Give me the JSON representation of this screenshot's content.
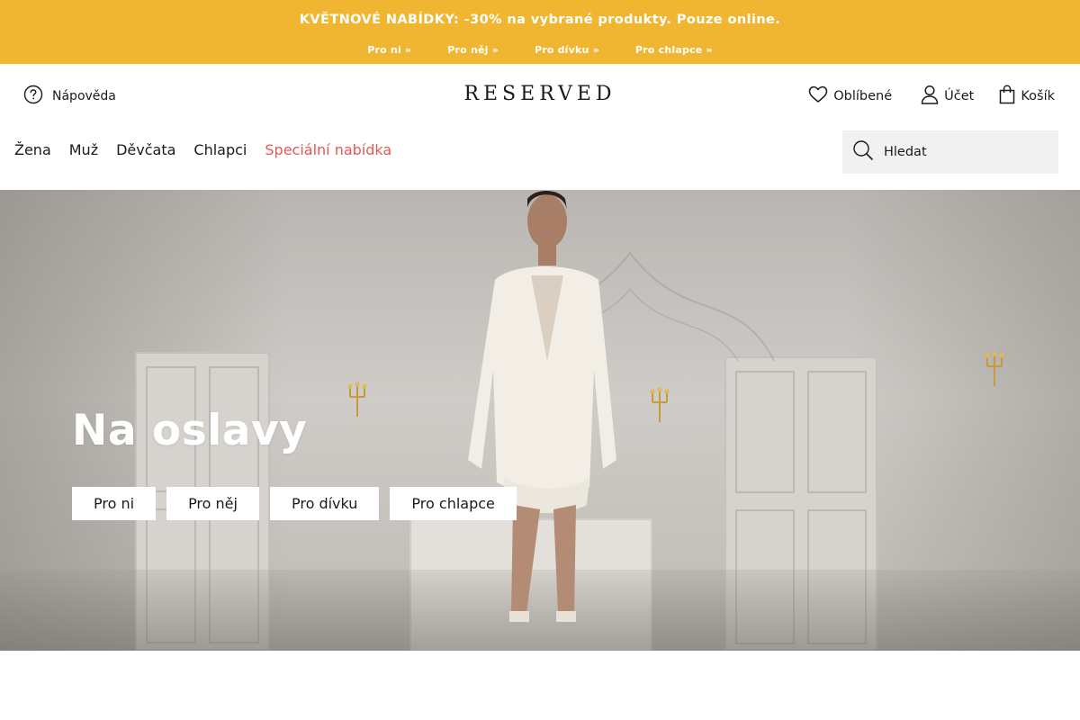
{
  "promo": {
    "headline": "KVĚTNOVÉ NABÍDKY: -30% na vybrané produkty. Pouze online.",
    "links": [
      "Pro ni »",
      "Pro něj »",
      "Pro dívku »",
      "Pro chlapce »"
    ]
  },
  "header": {
    "help_label": "Nápověda",
    "logo": "RESERVED",
    "favorites_label": "Oblíbené",
    "account_label": "Účet",
    "cart_label": "Košík"
  },
  "nav": {
    "items": [
      "Žena",
      "Muž",
      "Děvčata",
      "Chlapci",
      "Speciální nabídka"
    ]
  },
  "search": {
    "placeholder": "Hledat"
  },
  "hero": {
    "title": "Na oslavy",
    "buttons": [
      "Pro ni",
      "Pro něj",
      "Pro dívku",
      "Pro chlapce"
    ]
  },
  "colors": {
    "promo_bg": "#f1b631",
    "special_nav": "#e05a55",
    "search_bg": "#f1f1f1"
  },
  "icons": {
    "help": "question-circle-icon",
    "favorites": "heart-icon",
    "account": "user-icon",
    "cart": "shopping-bag-icon",
    "search": "search-icon"
  }
}
